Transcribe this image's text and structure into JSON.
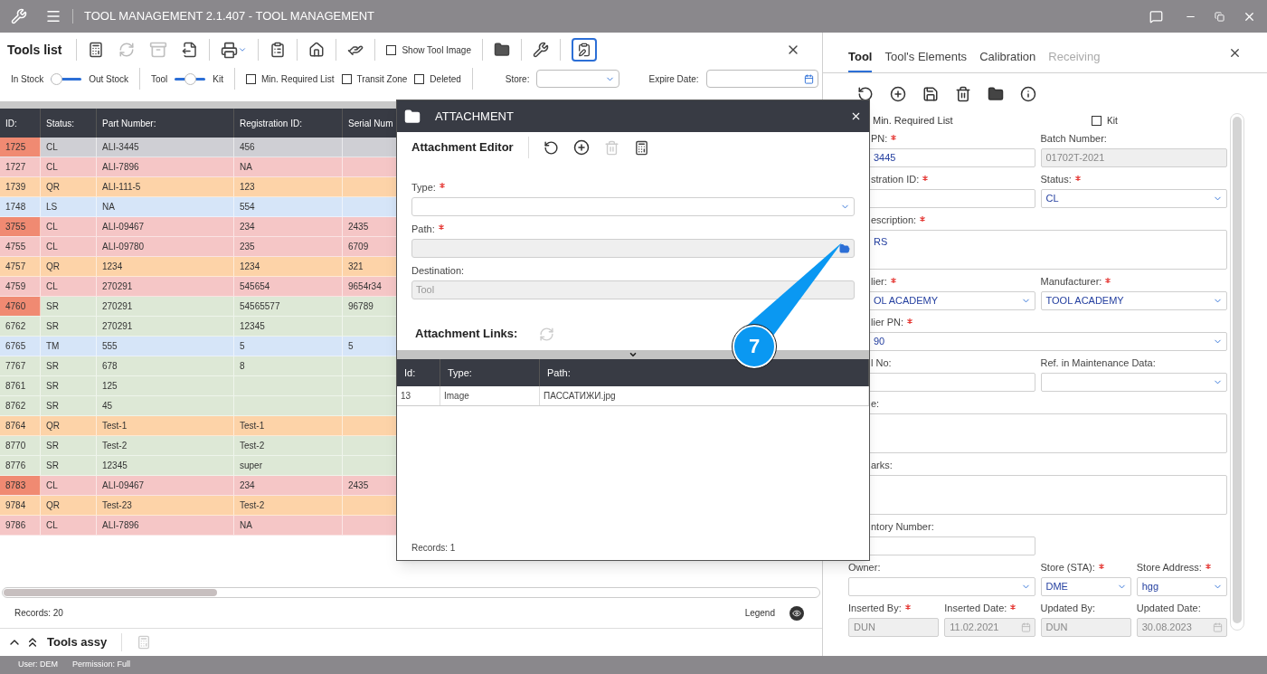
{
  "window": {
    "title": "TOOL MANAGEMENT 2.1.407 - TOOL MANAGEMENT"
  },
  "tools_list": {
    "title": "Tools list",
    "show_tool_image": {
      "label": "Show Tool Image",
      "checked": false
    },
    "toggles": [
      {
        "left": "In Stock",
        "right": "Out Stock",
        "level": 0
      },
      {
        "left": "Tool",
        "right": "Kit",
        "level": 0.5
      }
    ],
    "checkboxes": [
      {
        "label": "Min. Required List",
        "checked": false
      },
      {
        "label": "Transit Zone",
        "checked": false
      },
      {
        "label": "Deleted",
        "checked": false
      }
    ],
    "store": {
      "label": "Store:"
    },
    "expire_date": {
      "label": "Expire Date:"
    },
    "table": {
      "columns": [
        "ID:",
        "Status:",
        "Part Number:",
        "Registration ID:",
        "Serial Num"
      ],
      "rows": [
        {
          "cells": [
            "1725",
            "CL",
            "ALI-3445",
            "456",
            ""
          ],
          "selected": true,
          "id_alert": true
        },
        {
          "cells": [
            "1727",
            "CL",
            "ALI-7896",
            "NA",
            ""
          ],
          "color": "#f5c6c6",
          "selected": false,
          "id_alert": false
        },
        {
          "cells": [
            "1739",
            "QR",
            "ALI-111-5",
            "123",
            ""
          ],
          "color": "#fdd3a8",
          "selected": false,
          "id_alert": false
        },
        {
          "cells": [
            "1748",
            "LS",
            "NA",
            "554",
            ""
          ],
          "color": "#d6e5f8",
          "selected": false,
          "id_alert": false
        },
        {
          "cells": [
            "3755",
            "CL",
            "ALI-09467",
            "234",
            "2435"
          ],
          "color": "#f5c6c6",
          "selected": false,
          "id_alert": true
        },
        {
          "cells": [
            "4755",
            "CL",
            "ALI-09780",
            "235",
            "6709"
          ],
          "color": "#f5c6c6",
          "selected": false,
          "id_alert": false
        },
        {
          "cells": [
            "4757",
            "QR",
            "1234",
            "1234",
            "321"
          ],
          "color": "#fdd3a8",
          "selected": false,
          "id_alert": false
        },
        {
          "cells": [
            "4759",
            "CL",
            "270291",
            "545654",
            "9654r34"
          ],
          "color": "#f5c6c6",
          "selected": false,
          "id_alert": false
        },
        {
          "cells": [
            "4760",
            "SR",
            "270291",
            "54565577",
            "96789"
          ],
          "color": "#dde8d6",
          "selected": false,
          "id_alert": true
        },
        {
          "cells": [
            "6762",
            "SR",
            "270291",
            "12345",
            ""
          ],
          "color": "#dde8d6",
          "selected": false,
          "id_alert": false
        },
        {
          "cells": [
            "6765",
            "TM",
            "555",
            "5",
            "5"
          ],
          "color": "#d6e5f8",
          "selected": false,
          "id_alert": false
        },
        {
          "cells": [
            "7767",
            "SR",
            "678",
            "8",
            ""
          ],
          "color": "#dde8d6",
          "selected": false,
          "id_alert": false
        },
        {
          "cells": [
            "8761",
            "SR",
            "125",
            "",
            ""
          ],
          "color": "#dde8d6",
          "selected": false,
          "id_alert": false
        },
        {
          "cells": [
            "8762",
            "SR",
            "45",
            "",
            ""
          ],
          "color": "#dde8d6",
          "selected": false,
          "id_alert": false
        },
        {
          "cells": [
            "8764",
            "QR",
            "Test-1",
            "Test-1",
            ""
          ],
          "color": "#fdd3a8",
          "selected": false,
          "id_alert": false
        },
        {
          "cells": [
            "8770",
            "SR",
            "Test-2",
            "Test-2",
            ""
          ],
          "color": "#dde8d6",
          "selected": false,
          "id_alert": false
        },
        {
          "cells": [
            "8776",
            "SR",
            "12345",
            "super",
            ""
          ],
          "color": "#dde8d6",
          "selected": false,
          "id_alert": false
        },
        {
          "cells": [
            "8783",
            "CL",
            "ALI-09467",
            "234",
            "2435"
          ],
          "color": "#f5c6c6",
          "selected": false,
          "id_alert": true
        },
        {
          "cells": [
            "9784",
            "QR",
            "Test-23",
            "Test-2",
            ""
          ],
          "color": "#fdd3a8",
          "selected": false,
          "id_alert": false
        },
        {
          "cells": [
            "9786",
            "CL",
            "ALI-7896",
            "NA",
            ""
          ],
          "color": "#f5c6c6",
          "selected": false,
          "id_alert": false
        }
      ]
    },
    "records": "Records: 20",
    "legend": "Legend"
  },
  "tools_assy": {
    "title": "Tools assy"
  },
  "status_bar": [
    "User: DEM",
    "Permission: Full"
  ],
  "attachment": {
    "title": "ATTACHMENT",
    "editor_title": "Attachment Editor",
    "fields": [
      {
        "label": "Type:",
        "required": true,
        "kind": "select",
        "disabled": false
      },
      {
        "label": "Path:",
        "required": true,
        "kind": "file",
        "disabled": true
      },
      {
        "label": "Destination:",
        "required": false,
        "kind": "input",
        "value": "Tool",
        "disabled": true
      }
    ],
    "links_title": "Attachment Links:",
    "table": {
      "columns": [
        "Id:",
        "Type:",
        "Path:"
      ],
      "rows": [
        [
          "13",
          "Image",
          "ПАССАТИЖИ.jpg"
        ]
      ]
    },
    "records": "Records: 1"
  },
  "callout": {
    "number": "7"
  },
  "tool_panel": {
    "tabs": [
      {
        "label": "Tool",
        "selected": true,
        "disabled": false
      },
      {
        "label": "Tool's Elements",
        "selected": false,
        "disabled": false
      },
      {
        "label": "Calibration",
        "selected": false,
        "disabled": false
      },
      {
        "label": "Receiving",
        "selected": false,
        "disabled": true
      }
    ],
    "flags": [
      {
        "label": "Min. Required List",
        "cut": true
      },
      {
        "label": "Kit",
        "checked": false
      }
    ],
    "rows": [
      [
        {
          "label": "PN:",
          "required": true,
          "kind": "input",
          "value": "3445",
          "cut": true,
          "disabled": false
        },
        {
          "label": "Batch Number:",
          "required": false,
          "kind": "input",
          "value": "01702T-2021",
          "disabled": true
        }
      ],
      [
        {
          "label": "stration ID:",
          "required": true,
          "kind": "input",
          "cut": true,
          "disabled": false
        },
        {
          "label": "Status:",
          "required": true,
          "kind": "select",
          "value": "CL",
          "disabled": false
        }
      ],
      [
        {
          "label": "escription:",
          "required": true,
          "kind": "textarea",
          "value": "RS",
          "cut": true,
          "disabled": false
        }
      ],
      [
        {
          "label": "lier:",
          "required": true,
          "kind": "select",
          "value": "OL ACADEMY",
          "cut": true,
          "disabled": false
        },
        {
          "label": "Manufacturer:",
          "required": true,
          "kind": "select",
          "value": "TOOL ACADEMY",
          "disabled": false
        }
      ],
      [
        {
          "label": "lier PN:",
          "required": true,
          "kind": "select",
          "value": "90",
          "cut": true,
          "disabled": false
        }
      ],
      [
        {
          "label": "l No:",
          "required": false,
          "kind": "input",
          "cut": true,
          "disabled": false
        },
        {
          "label": "Ref. in Maintenance Data:",
          "required": false,
          "kind": "select",
          "disabled": false
        }
      ],
      [
        {
          "label": "e:",
          "required": false,
          "kind": "textarea",
          "cut": true,
          "disabled": false
        }
      ],
      [
        {
          "label": "arks:",
          "required": false,
          "kind": "textarea",
          "cut": true,
          "disabled": false
        }
      ],
      [
        {
          "label": "ntory Number:",
          "required": false,
          "kind": "input",
          "cut": true,
          "disabled": false
        }
      ]
    ],
    "owner": {
      "label": "Owner:",
      "required": false,
      "kind": "select",
      "disabled": false
    },
    "store": [
      {
        "label": "Store (STA):",
        "required": true,
        "kind": "select",
        "value": "DME",
        "disabled": false
      },
      {
        "label": "Store Address:",
        "required": true,
        "kind": "select",
        "value": "hgg",
        "disabled": false
      }
    ],
    "audit": [
      {
        "label": "Inserted By:",
        "required": true,
        "kind": "input",
        "value": "DUN",
        "disabled": true
      },
      {
        "label": "Inserted Date:",
        "required": true,
        "kind": "date",
        "value": "11.02.2021",
        "disabled": true
      },
      {
        "label": "Updated By:",
        "required": false,
        "kind": "input",
        "value": "DUN",
        "disabled": true
      },
      {
        "label": "Updated Date:",
        "required": false,
        "kind": "date",
        "value": "30.08.2023",
        "disabled": true
      }
    ]
  }
}
